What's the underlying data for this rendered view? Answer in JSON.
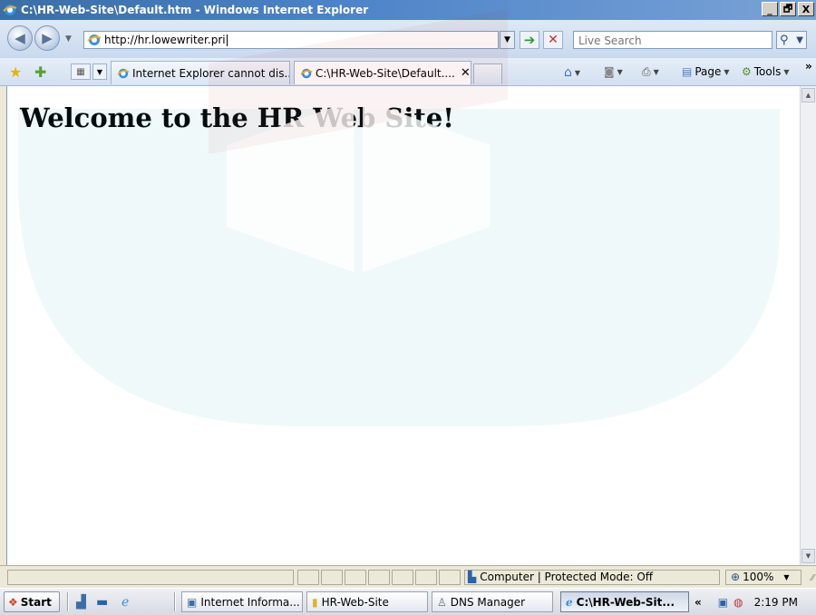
{
  "window": {
    "title": "C:\\HR-Web-Site\\Default.htm - Windows Internet Explorer",
    "min_label": "_",
    "max_label": "🗗",
    "close_label": "X"
  },
  "addressbar": {
    "url": "http://hr.lowewriter.pri",
    "search_placeholder": "Live Search"
  },
  "tabs": [
    {
      "label": "Internet Explorer cannot dis..."
    },
    {
      "label": "C:\\HR-Web-Site\\Default....",
      "close": "✕"
    }
  ],
  "commandbar": {
    "page_label": "Page",
    "tools_label": "Tools",
    "more": "»"
  },
  "page": {
    "heading": "Welcome to the HR Web Site!"
  },
  "statusbar": {
    "zone_text": "Computer | Protected Mode: Off",
    "zoom_text": "100%"
  },
  "taskbar": {
    "start_label": "Start",
    "items": [
      {
        "label": "Internet Informa..."
      },
      {
        "label": "HR-Web-Site"
      },
      {
        "label": "DNS Manager"
      },
      {
        "label": "C:\\HR-Web-Sit..."
      }
    ],
    "tray_expand": "«",
    "clock": "2:19 PM"
  },
  "colors": {
    "titlebar": "#3a6ea5",
    "watermark": "#27a7b6"
  }
}
